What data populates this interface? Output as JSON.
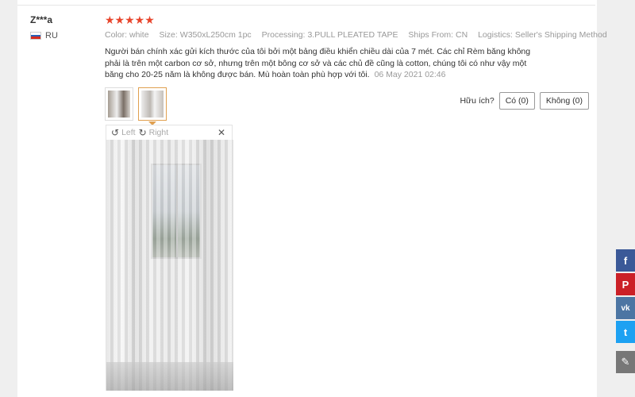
{
  "reviewer": {
    "name": "Z***a",
    "country": "RU"
  },
  "review": {
    "stars": "★★★★★",
    "specs": [
      {
        "label": "Color:",
        "value": "white"
      },
      {
        "label": "Size:",
        "value": "W350xL250cm 1pc"
      },
      {
        "label": "Processing:",
        "value": "3.PULL PLEATED TAPE"
      },
      {
        "label": "Ships From:",
        "value": "CN"
      },
      {
        "label": "Logistics:",
        "value": "Seller's Shipping Method"
      }
    ],
    "text": "Người bán chính xác gửi kích thước của tôi bởi một bảng điều khiển chiều dài của 7 mét. Các chỉ Rèm băng không phải là trên một carbon cơ sở, nhưng trên một bông cơ sở và các chủ đề cũng là cotton, chúng tôi có như vậy một băng cho 20-25 năm là không được bán. Mù hoàn toàn phù hợp với tôi.",
    "date": "06 May 2021 02:46"
  },
  "helpful": {
    "label": "Hữu ích?",
    "yes": "Có (0)",
    "no": "Không (0)"
  },
  "viewer": {
    "left": "Left",
    "right": "Right",
    "rotate_left_icon": "↺",
    "rotate_right_icon": "↻",
    "close_icon": "✕"
  },
  "share": {
    "facebook": "f",
    "pinterest": "P",
    "vk": "vk",
    "twitter": "t",
    "edit": "✎"
  },
  "colors": {
    "stars": "#e8462d",
    "accent_border": "#e0a050"
  }
}
